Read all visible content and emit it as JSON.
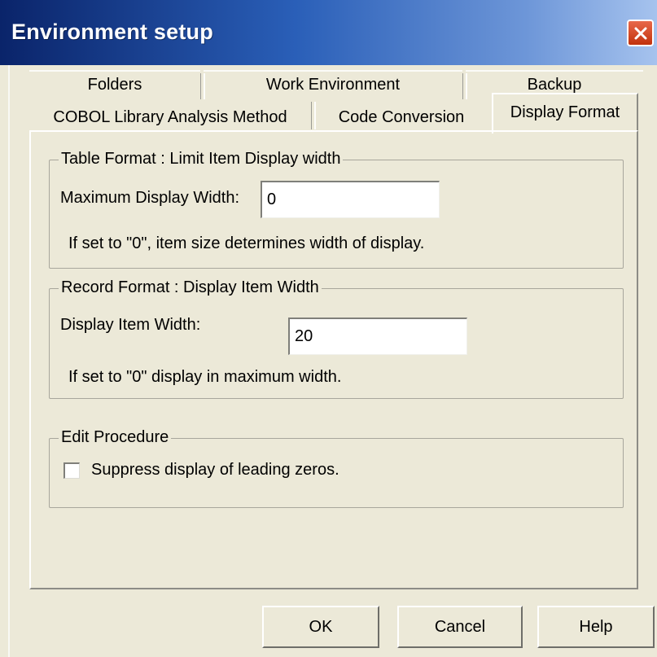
{
  "window": {
    "title": "Environment setup"
  },
  "tabs": {
    "back_row": [
      "Folders",
      "Work Environment",
      "Backup"
    ],
    "front_row": [
      "COBOL Library Analysis Method",
      "Code Conversion",
      "Display Format"
    ],
    "active": "Display Format"
  },
  "table_format": {
    "legend": "Table Format : Limit Item Display width",
    "field_label": "Maximum Display Width:",
    "value": "0",
    "hint": "If set to \"0\", item size determines width of display."
  },
  "record_format": {
    "legend": "Record Format : Display Item Width",
    "field_label": "Display Item Width:",
    "value": "20",
    "hint": "If set to \"0\" display in maximum width."
  },
  "edit_procedure": {
    "legend": "Edit Procedure",
    "checkbox_label": "Suppress display of leading zeros.",
    "checked": false
  },
  "buttons": {
    "ok": "OK",
    "cancel": "Cancel",
    "help": "Help"
  },
  "colors": {
    "title_start": "#0a246a",
    "title_end": "#a6c3ee",
    "close_button": "#c2320c",
    "face": "#ece9d8"
  }
}
